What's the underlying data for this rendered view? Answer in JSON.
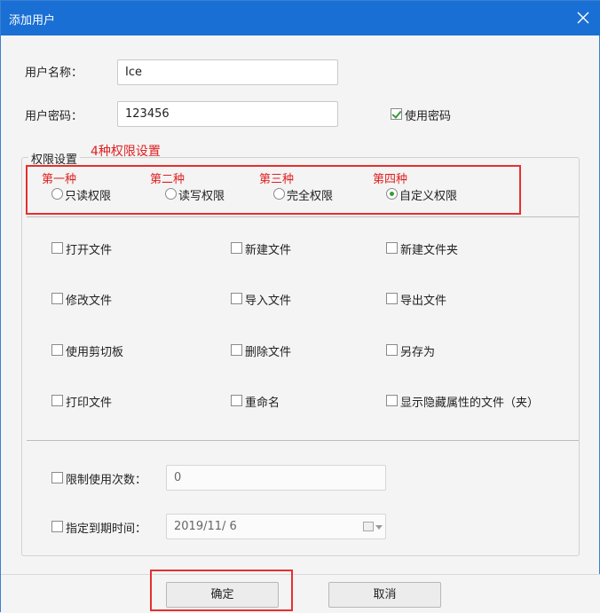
{
  "window": {
    "title": "添加用户"
  },
  "user": {
    "name_label": "用户名称：",
    "name_value": "Ice",
    "password_label": "用户密码：",
    "password_value": "123456",
    "use_password_label": "使用密码",
    "use_password_checked": true
  },
  "annotations": {
    "four_types": "4种权限设置",
    "first": "第一种",
    "second": "第二种",
    "third": "第三种",
    "fourth": "第四种"
  },
  "permissions": {
    "group_title": "权限设置",
    "modes": [
      {
        "label": "只读权限",
        "checked": false
      },
      {
        "label": "读写权限",
        "checked": false
      },
      {
        "label": "完全权限",
        "checked": false
      },
      {
        "label": "自定义权限",
        "checked": true
      }
    ],
    "options": [
      "打开文件",
      "新建文件",
      "新建文件夹",
      "修改文件",
      "导入文件",
      "导出文件",
      "使用剪切板",
      "删除文件",
      "另存为",
      "打印文件",
      "重命名",
      "显示隐藏属性的文件（夹）"
    ]
  },
  "limits": {
    "use_count_label": "限制使用次数：",
    "use_count_value": "0",
    "expiry_label": "指定到期时间：",
    "expiry_value": "2019/11/  6"
  },
  "buttons": {
    "ok": "确定",
    "cancel": "取消"
  },
  "colors": {
    "titlebar": "#1a6fd4",
    "annotation": "#e02020",
    "check": "#3a9a3a"
  }
}
